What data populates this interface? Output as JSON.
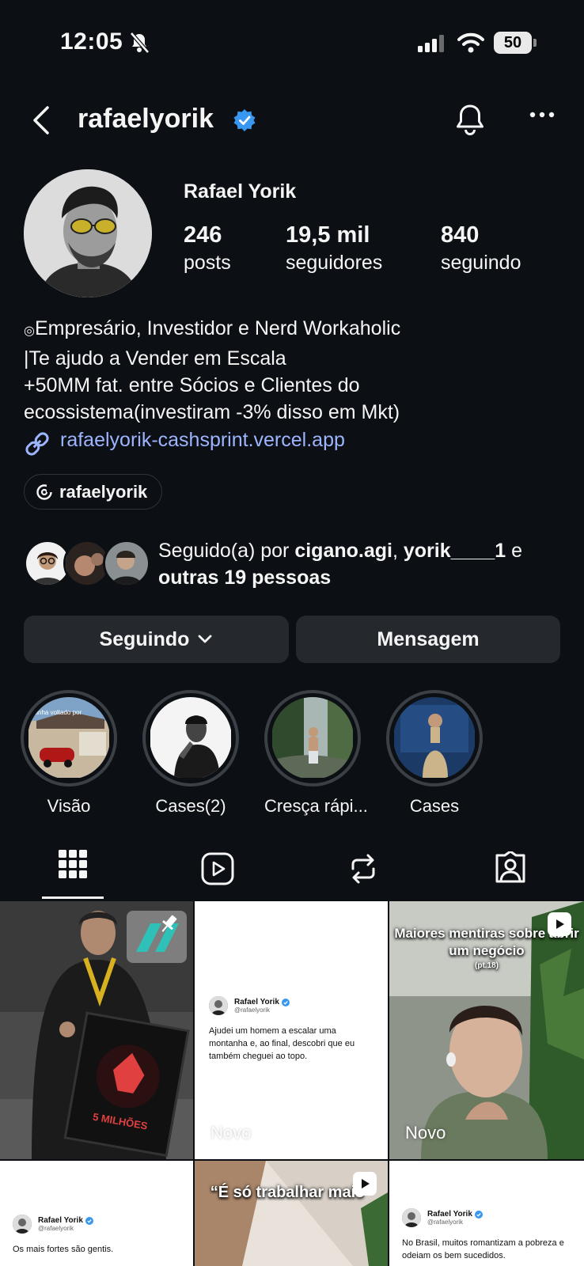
{
  "status_bar": {
    "time": "12:05",
    "battery": "50"
  },
  "header": {
    "username": "rafaelyorik"
  },
  "profile": {
    "full_name": "Rafael Yorik",
    "stats": [
      {
        "value": "246",
        "label": "posts"
      },
      {
        "value": "19,5 mil",
        "label": "seguidores"
      },
      {
        "value": "840",
        "label": "seguindo"
      }
    ],
    "bio_icon": "◎",
    "bio": "Empresário, Investidor e Nerd Workaholic\n|Te ajudo a Vender em Escala\n+50MM fat. entre Sócios e Clientes do\necossistema(investiram -3% disso em Mkt)",
    "link": "rafaelyorik-cashsprint.vercel.app",
    "threads_handle": "rafaelyorik"
  },
  "followed_by": {
    "prefix": "Seguido(a) por ",
    "user1": "cigano.agi",
    "separator": ", ",
    "user2": "yorik____1",
    "conj": " e ",
    "others": "outras 19 pessoas"
  },
  "actions": {
    "following": "Seguindo",
    "message": "Mensagem"
  },
  "highlights": [
    {
      "label": "Visão",
      "overlay": "tinha voltado por"
    },
    {
      "label": "Cases(2)"
    },
    {
      "label": "Cresça rápi..."
    },
    {
      "label": "Cases"
    }
  ],
  "tabs": [
    "grid-icon",
    "reels-icon",
    "reposts-icon",
    "tagged-icon"
  ],
  "grid": {
    "post1": {
      "plaque_text": "5 MILHÕES"
    },
    "post2": {
      "name": "Rafael Yorik",
      "handle": "@rafaelyorik",
      "text": "Ajudei um homem a escalar uma montanha e, ao final, descobri que eu também cheguei ao topo.",
      "badge": "Novo"
    },
    "post3": {
      "title": "Maiores mentiras sobre abrir um negócio",
      "subtitle": "(pt.18)",
      "badge": "Novo"
    },
    "post4": {
      "name": "Rafael Yorik",
      "handle": "@rafaelyorik",
      "text": "Os mais fortes são gentis."
    },
    "post5": {
      "title": "“É só trabalhar mais”"
    },
    "post6": {
      "name": "Rafael Yorik",
      "handle": "@rafaelyorik",
      "text": "No Brasil, muitos romantizam a pobreza e odeiam os bem sucedidos."
    }
  },
  "colors": {
    "background": "#0c1014",
    "link": "#9db4ff",
    "verified": "#3897f0",
    "button": "#25292e"
  }
}
